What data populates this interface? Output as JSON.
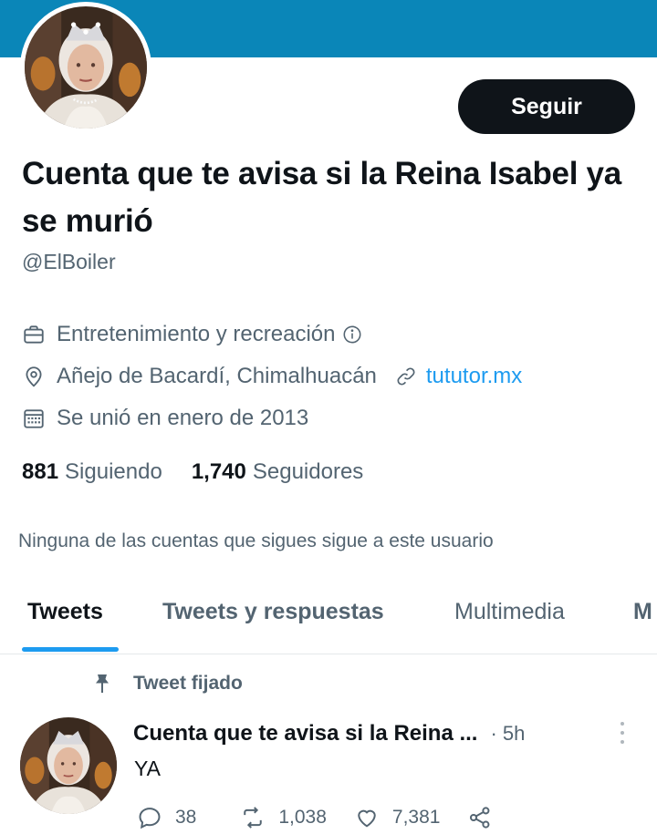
{
  "profile": {
    "follow_label": "Seguir",
    "display_name": "Cuenta que te avisa si la Reina Isabel ya se murió",
    "handle": "@ElBoiler",
    "category": "Entretenimiento y recreación",
    "location": "Añejo de Bacardí, Chimalhuacán",
    "website": "tututor.mx",
    "joined": "Se unió en enero de 2013",
    "following_count": "881",
    "following_label": "Siguiendo",
    "followers_count": "1,740",
    "followers_label": "Seguidores",
    "mutuals_note": "Ninguna de las cuentas que sigues sigue a este usuario"
  },
  "tabs": [
    {
      "label": "Tweets",
      "active": true
    },
    {
      "label": "Tweets y respuestas",
      "active": false
    },
    {
      "label": "Multimedia",
      "active": false
    },
    {
      "label": "M",
      "active": false
    }
  ],
  "pinned_tweet": {
    "pinned_label": "Tweet fijado",
    "author_name": "Cuenta que te avisa si la Reina ...",
    "time": "· 5h",
    "text": "YA",
    "replies": "38",
    "retweets": "1,038",
    "likes": "7,381"
  },
  "colors": {
    "banner": "#0a86b8",
    "accent": "#1d9bf0",
    "primary_text": "#0f1419",
    "secondary_text": "#536471",
    "button_bg": "#0f1419"
  },
  "icons": {
    "category": "briefcase-icon",
    "location": "location-pin-icon",
    "website": "link-icon",
    "joined": "calendar-icon",
    "info": "info-icon",
    "pinned": "pin-icon",
    "reply": "reply-icon",
    "retweet": "retweet-icon",
    "like": "heart-icon",
    "share": "share-icon",
    "more": "more-vertical-icon"
  }
}
